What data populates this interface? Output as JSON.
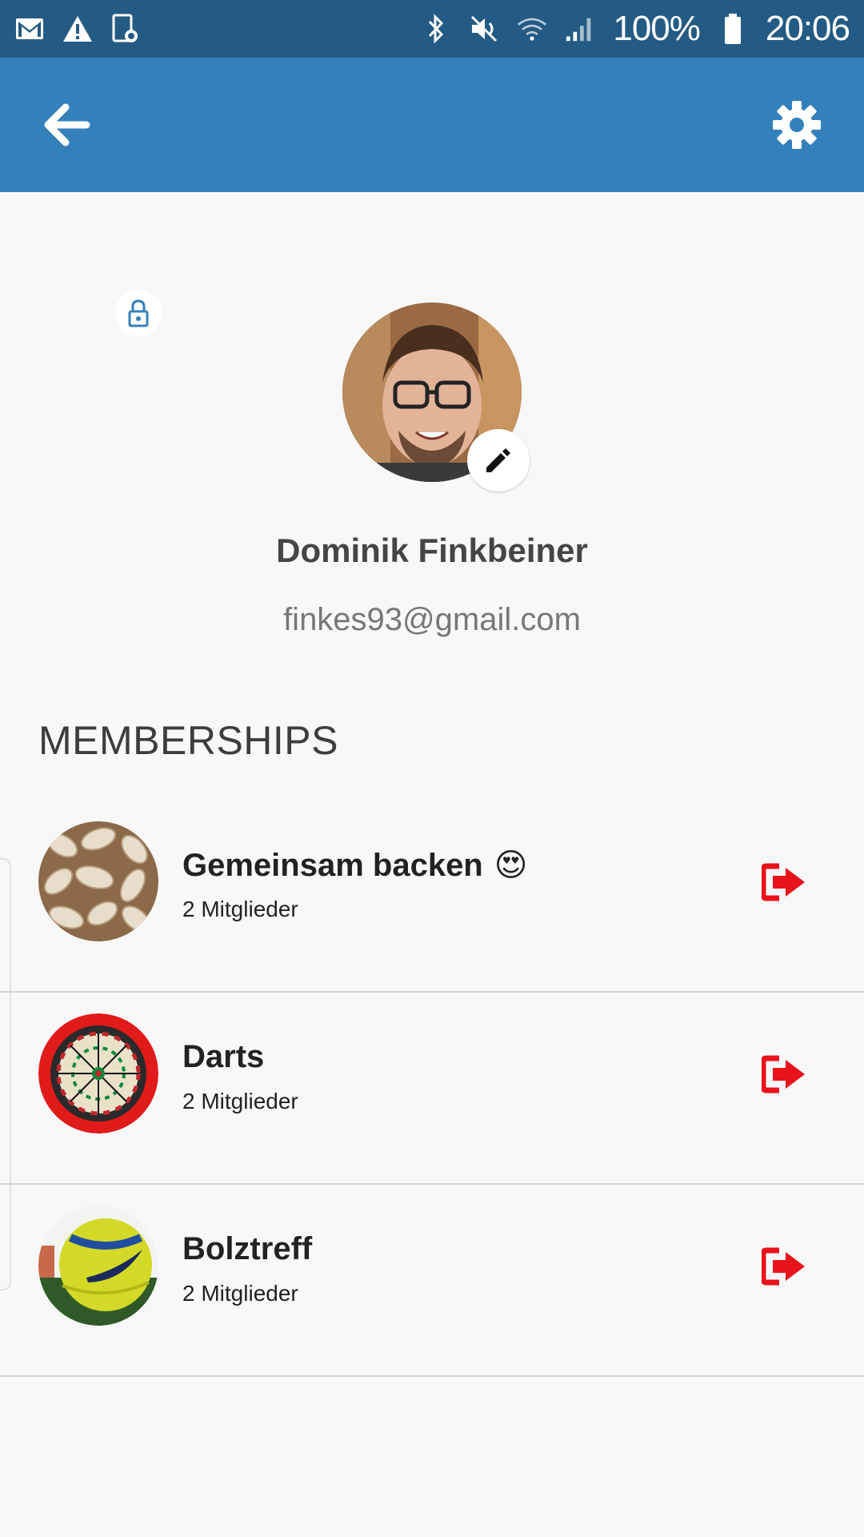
{
  "status_bar": {
    "battery": "100%",
    "time": "20:06",
    "icons": [
      "gmail-icon",
      "warning-icon",
      "screenshot-icon",
      "bluetooth-icon",
      "mute-icon",
      "wifi-icon",
      "signal-icon",
      "battery-icon"
    ]
  },
  "app_bar": {
    "back_icon": "arrow-left-icon",
    "settings_icon": "gear-icon",
    "color": "#3480bb"
  },
  "profile": {
    "name": "Dominik Finkbeiner",
    "email": "finkes93@gmail.com",
    "edit_icon": "pencil-icon"
  },
  "memberships": {
    "title": "MEMBERSHIPS",
    "items": [
      {
        "name": "Gemeinsam backen",
        "emoji": "😍",
        "members": "2 Mitglieder",
        "image": "cashews-image",
        "locked": false
      },
      {
        "name": "Darts",
        "members": "2 Mitglieder",
        "image": "dartboard-image",
        "locked": true
      },
      {
        "name": "Bolztreff",
        "members": "2 Mitglieder",
        "image": "football-image",
        "locked": false
      }
    ],
    "leave_icon": "sign-out-icon",
    "leave_color": "#e8131b"
  }
}
